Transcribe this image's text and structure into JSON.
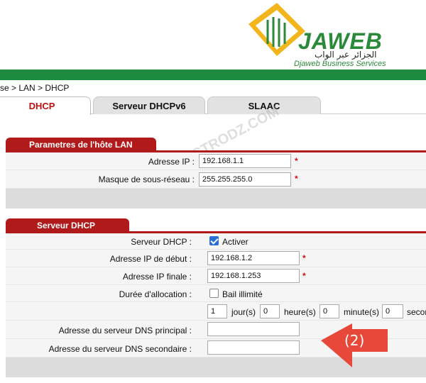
{
  "brand": {
    "name": "JAWEB",
    "arabic": "الجزائر عبر الواب",
    "subtitle": "Djaweb Business Services"
  },
  "watermark": "WWW.ELECTRODZ.COM",
  "breadcrumb": "se > LAN > DHCP",
  "tabs": [
    {
      "label": "DHCP",
      "active": true
    },
    {
      "label": "Serveur DHCPv6",
      "active": false
    },
    {
      "label": "SLAAC",
      "active": false
    }
  ],
  "lan": {
    "title": "Parametres de l'hôte LAN",
    "ip_label": "Adresse IP :",
    "ip_value": "192.168.1.1",
    "mask_label": "Masque de sous-réseau :",
    "mask_value": "255.255.255.0",
    "required_mark": "*"
  },
  "dhcp": {
    "title": "Serveur DHCP",
    "server_label": "Serveur DHCP :",
    "server_enabled": true,
    "activer_label": "Activer",
    "start_label": "Adresse IP de début :",
    "start_value": "192.168.1.2",
    "end_label": "Adresse IP finale :",
    "end_value": "192.168.1.253",
    "lease_label": "Durée d'allocation :",
    "unlimited_checked": false,
    "unlimited_label": "Bail illimité",
    "days_value": "1",
    "days_label": "jour(s)",
    "hours_value": "0",
    "hours_label": "heure(s)",
    "minutes_value": "0",
    "minutes_label": "minute(s)",
    "seconds_value": "0",
    "seconds_label": "secon",
    "dns1_label": "Adresse du serveur DNS principal :",
    "dns1_value": "",
    "dns2_label": "Adresse du serveur DNS secondaire :",
    "dns2_value": ""
  },
  "callout": {
    "label": "(2)",
    "color": "#e8483a"
  },
  "colors": {
    "accent_red": "#b01a1a",
    "brand_green": "#1e8a3e",
    "brand_yellow": "#f2b61c",
    "checkbox_blue": "#2a6fd6"
  }
}
